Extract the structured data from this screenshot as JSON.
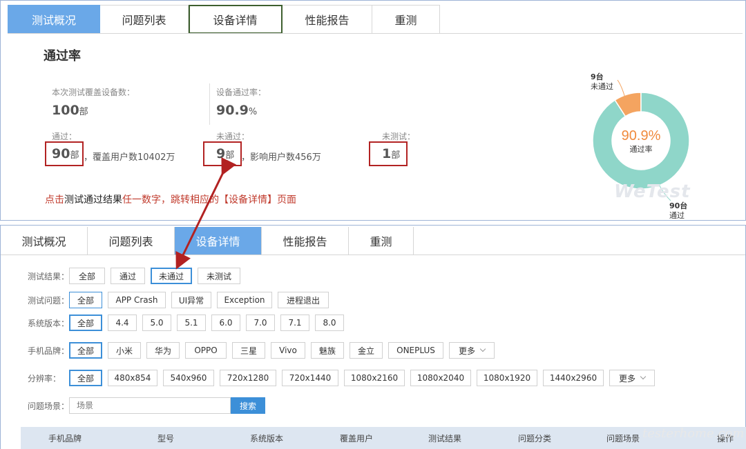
{
  "top_panel": {
    "tabs": [
      {
        "label": "测试概况",
        "active": true,
        "boxed": false
      },
      {
        "label": "问题列表",
        "active": false,
        "boxed": false
      },
      {
        "label": "设备详情",
        "active": false,
        "boxed": true
      },
      {
        "label": "性能报告",
        "active": false,
        "boxed": false
      },
      {
        "label": "重测",
        "active": false,
        "boxed": false
      }
    ],
    "title": "通过率",
    "coverage_label": "本次测试覆盖设备数：",
    "coverage_value": "100",
    "coverage_unit": "部",
    "pass_rate_label": "设备通过率：",
    "pass_rate_value": "90.9",
    "pass_rate_unit": "%",
    "passed_label": "通过：",
    "passed_value": "90",
    "passed_unit": "部",
    "passed_extra": "，覆盖用户数10402万",
    "failed_label": "未通过：",
    "failed_value": "9",
    "failed_unit": "部",
    "failed_extra": "，影响用户数456万",
    "untested_label": "未测试：",
    "untested_value": "1",
    "untested_unit": "部",
    "note_part1": "点击",
    "note_part2": "测试通过结果",
    "note_part3": "任一数字，跳转相应的【设备详情】页面",
    "watermark": "WeTest"
  },
  "chart_data": {
    "type": "pie",
    "center_value": "90.9%",
    "center_label": "通过率",
    "slices": [
      {
        "name": "通过",
        "count_label": "90台",
        "value": 90,
        "color": "#8fd6c9"
      },
      {
        "name": "未通过",
        "count_label": "9台",
        "value": 9,
        "color": "#f4a460"
      }
    ],
    "accent_color": "#f08a3c"
  },
  "bottom_panel": {
    "tabs": [
      {
        "label": "测试概况",
        "active": false
      },
      {
        "label": "问题列表",
        "active": false
      },
      {
        "label": "设备详情",
        "active": true
      },
      {
        "label": "性能报告",
        "active": false
      },
      {
        "label": "重测",
        "active": false
      }
    ],
    "filters": {
      "result": {
        "label": "测试结果：",
        "options": [
          "全部",
          "通过",
          "未通过",
          "未测试"
        ]
      },
      "issue": {
        "label": "测试问题：",
        "options": [
          "全部",
          "APP Crash",
          "UI异常",
          "Exception",
          "进程退出"
        ]
      },
      "os_version": {
        "label": "系统版本：",
        "options": [
          "全部",
          "4.4",
          "5.0",
          "5.1",
          "6.0",
          "7.0",
          "7.1",
          "8.0"
        ]
      },
      "brand": {
        "label": "手机品牌：",
        "options": [
          "全部",
          "小米",
          "华为",
          "OPPO",
          "三星",
          "Vivo",
          "魅族",
          "金立",
          "ONEPLUS"
        ],
        "more": "更多"
      },
      "resolution": {
        "label": "分辨率：",
        "options": [
          "全部",
          "480x854",
          "540x960",
          "720x1280",
          "720x1440",
          "1080x2160",
          "1080x2040",
          "1080x1920",
          "1440x2960"
        ],
        "more": "更多"
      }
    },
    "search": {
      "label": "问题场景：",
      "placeholder": "场景",
      "button": "搜索"
    },
    "table_headers": [
      "手机品牌",
      "型号",
      "系统版本",
      "覆盖用户",
      "测试结果",
      "问题分类",
      "问题场景",
      "操作"
    ],
    "watermark": "testerhome.com"
  },
  "colors": {
    "tab_active": "#6aa8e8",
    "highlight_red": "#b22222",
    "primary_blue": "#3c8fd8",
    "table_header_bg": "#dde6f1"
  }
}
